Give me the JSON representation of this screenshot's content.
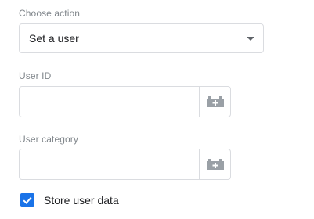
{
  "action": {
    "label": "Choose action",
    "selected": "Set a user"
  },
  "user_id": {
    "label": "User ID",
    "value": "",
    "variable_button_icon": "variable-picker-icon"
  },
  "user_category": {
    "label": "User category",
    "value": "",
    "variable_button_icon": "variable-picker-icon"
  },
  "store_user_data": {
    "label": "Store user data",
    "checked": true
  },
  "colors": {
    "accent": "#1a73e8",
    "border": "#dadce0",
    "label": "#80868b",
    "icon": "#9aa0a6"
  }
}
